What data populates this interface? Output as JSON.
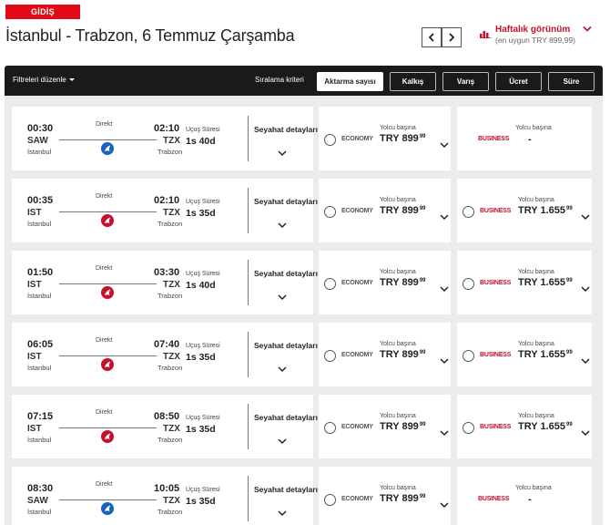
{
  "header": {
    "badge": "GİDİŞ",
    "route_title": "İstanbul - Trabzon, 6 Temmuz Çarşamba",
    "weekly_title": "Haftalık görünüm",
    "weekly_sub": "(en uygun TRY 899,99)"
  },
  "toolbar": {
    "filter_label": "Filtreleri düzenle",
    "sort_label": "Sıralama kriteri",
    "sort_options": [
      "Aktarma sayısı",
      "Kalkış",
      "Varış",
      "Ücret",
      "Süre"
    ],
    "active_sort": 0
  },
  "labels": {
    "direct": "Direkt",
    "duration_label": "Uçuş Süresi",
    "details": "Seyahat detayları",
    "per_passenger": "Yolcu başına",
    "economy": "ECONOMY",
    "business": "BUSINESS"
  },
  "colors": {
    "brand_red": "#c8102e",
    "anadolujet_blue": "#1565c0",
    "toolbar_bg": "#1a1a1a"
  },
  "flights": [
    {
      "dep_time": "00:30",
      "dep_code": "SAW",
      "dep_city": "İstanbul",
      "arr_time": "02:10",
      "arr_code": "TZX",
      "arr_city": "Trabzon",
      "duration": "1s 40d",
      "airline": "anadolujet-blue",
      "economy_price": "TRY 899",
      "economy_cents": "99",
      "business_available": false,
      "business_price": "-",
      "business_cents": ""
    },
    {
      "dep_time": "00:35",
      "dep_code": "IST",
      "dep_city": "İstanbul",
      "arr_time": "02:10",
      "arr_code": "TZX",
      "arr_city": "Trabzon",
      "duration": "1s 35d",
      "airline": "thy-red",
      "economy_price": "TRY 899",
      "economy_cents": "99",
      "business_available": true,
      "business_price": "TRY 1.655",
      "business_cents": "99"
    },
    {
      "dep_time": "01:50",
      "dep_code": "IST",
      "dep_city": "İstanbul",
      "arr_time": "03:30",
      "arr_code": "TZX",
      "arr_city": "Trabzon",
      "duration": "1s 40d",
      "airline": "thy-red",
      "economy_price": "TRY 899",
      "economy_cents": "99",
      "business_available": true,
      "business_price": "TRY 1.655",
      "business_cents": "99"
    },
    {
      "dep_time": "06:05",
      "dep_code": "IST",
      "dep_city": "İstanbul",
      "arr_time": "07:40",
      "arr_code": "TZX",
      "arr_city": "Trabzon",
      "duration": "1s 35d",
      "airline": "thy-red",
      "economy_price": "TRY 899",
      "economy_cents": "99",
      "business_available": true,
      "business_price": "TRY 1.655",
      "business_cents": "99"
    },
    {
      "dep_time": "07:15",
      "dep_code": "IST",
      "dep_city": "İstanbul",
      "arr_time": "08:50",
      "arr_code": "TZX",
      "arr_city": "Trabzon",
      "duration": "1s 35d",
      "airline": "thy-red",
      "economy_price": "TRY 899",
      "economy_cents": "99",
      "business_available": true,
      "business_price": "TRY 1.655",
      "business_cents": "99"
    },
    {
      "dep_time": "08:30",
      "dep_code": "SAW",
      "dep_city": "İstanbul",
      "arr_time": "10:05",
      "arr_code": "TZX",
      "arr_city": "Trabzon",
      "duration": "1s 35d",
      "airline": "anadolujet-blue",
      "economy_price": "TRY 899",
      "economy_cents": "99",
      "business_available": false,
      "business_price": "-",
      "business_cents": ""
    }
  ]
}
